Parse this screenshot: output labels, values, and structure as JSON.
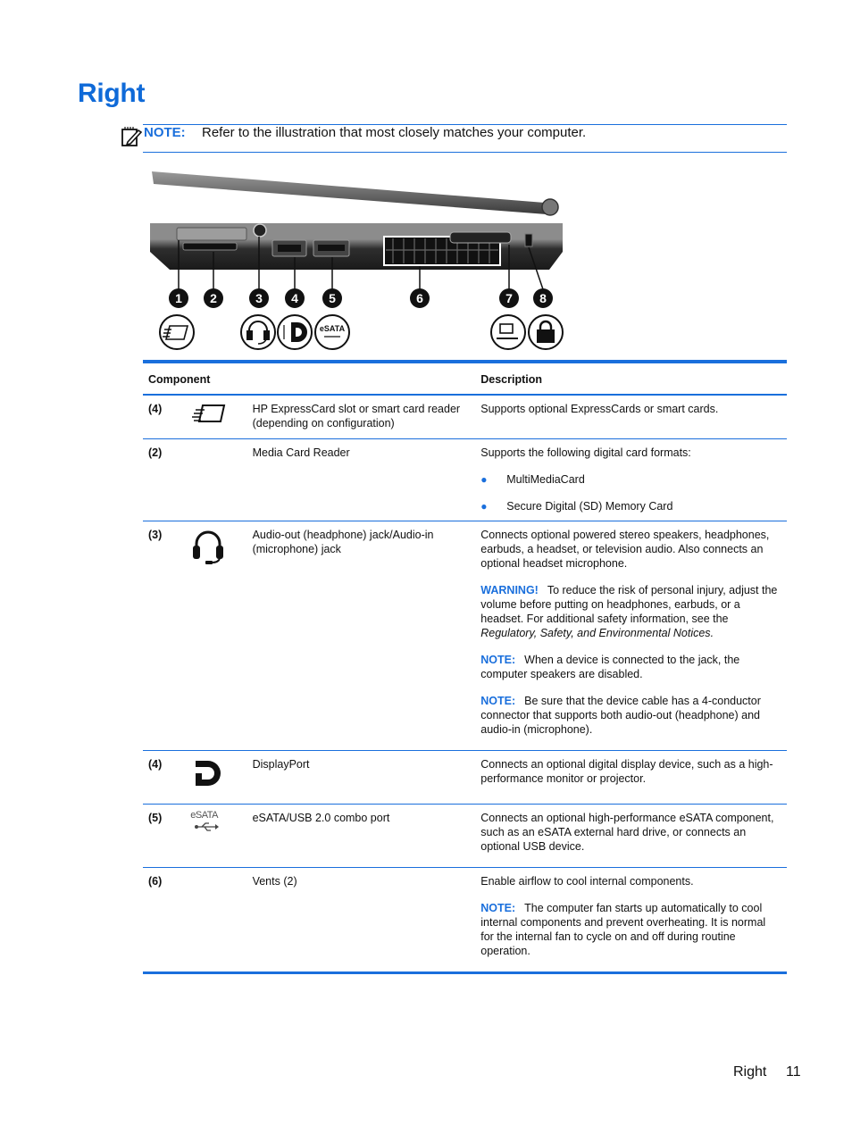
{
  "page": {
    "title": "Right",
    "note": {
      "label": "NOTE:",
      "text": "Refer to the illustration that most closely matches your computer."
    },
    "illustration": {
      "callouts": [
        "1",
        "2",
        "3",
        "4",
        "5",
        "6",
        "7",
        "8"
      ],
      "icon_names": [
        "expresscard-icon",
        "",
        "headset-icon",
        "displayport-icon",
        "esata-usb-icon",
        "",
        "docking-connector-icon",
        "security-lock-icon"
      ],
      "esata_label": "eSATA"
    },
    "table": {
      "headers": {
        "component": "Component",
        "description": "Description"
      },
      "rows": [
        {
          "number": "(4)",
          "icon": "expresscard-icon",
          "name": "HP ExpressCard slot or smart card reader (depending on configuration)",
          "description": [
            "Supports optional ExpressCards or smart cards."
          ]
        },
        {
          "number": "(2)",
          "icon": "",
          "name": "Media Card Reader",
          "description": [
            "Supports the following digital card formats:"
          ],
          "bullets": [
            "MultiMediaCard",
            "Secure Digital (SD) Memory Card"
          ]
        },
        {
          "number": "(3)",
          "icon": "headset-icon",
          "name": "Audio-out (headphone) jack/Audio-in (microphone) jack",
          "description": [
            "Connects optional powered stereo speakers, headphones, earbuds, a headset, or television audio. Also connects an optional headset microphone."
          ],
          "warning": {
            "label": "WARNING!",
            "text": "To reduce the risk of personal injury, adjust the volume before putting on headphones, earbuds, or a headset. For additional safety information, see the",
            "italic": "Regulatory, Safety, and Environmental Notices",
            "end": "."
          },
          "notes": [
            {
              "label": "NOTE:",
              "text": "When a device is connected to the jack, the computer speakers are disabled."
            },
            {
              "label": "NOTE:",
              "text": "Be sure that the device cable has a 4-conductor connector that supports both audio-out (headphone) and audio-in (microphone)."
            }
          ]
        },
        {
          "number": "(4)",
          "icon": "displayport-icon",
          "name": "DisplayPort",
          "description": [
            "Connects an optional digital display device, such as a high-performance monitor or projector."
          ]
        },
        {
          "number": "(5)",
          "icon": "esata-usb-icon",
          "icon_text": "eSATA",
          "name": "eSATA/USB 2.0 combo port",
          "description": [
            "Connects an optional high-performance eSATA component, such as an eSATA external hard drive, or connects an optional USB device."
          ]
        },
        {
          "number": "(6)",
          "icon": "",
          "name": "Vents (2)",
          "description": [
            "Enable airflow to cool internal components."
          ],
          "notes": [
            {
              "label": "NOTE:",
              "text": "The computer fan starts up automatically to cool internal components and prevent overheating. It is normal for the internal fan to cycle on and off during routine operation."
            }
          ]
        }
      ]
    },
    "footer": {
      "section": "Right",
      "page_number": "11"
    }
  }
}
